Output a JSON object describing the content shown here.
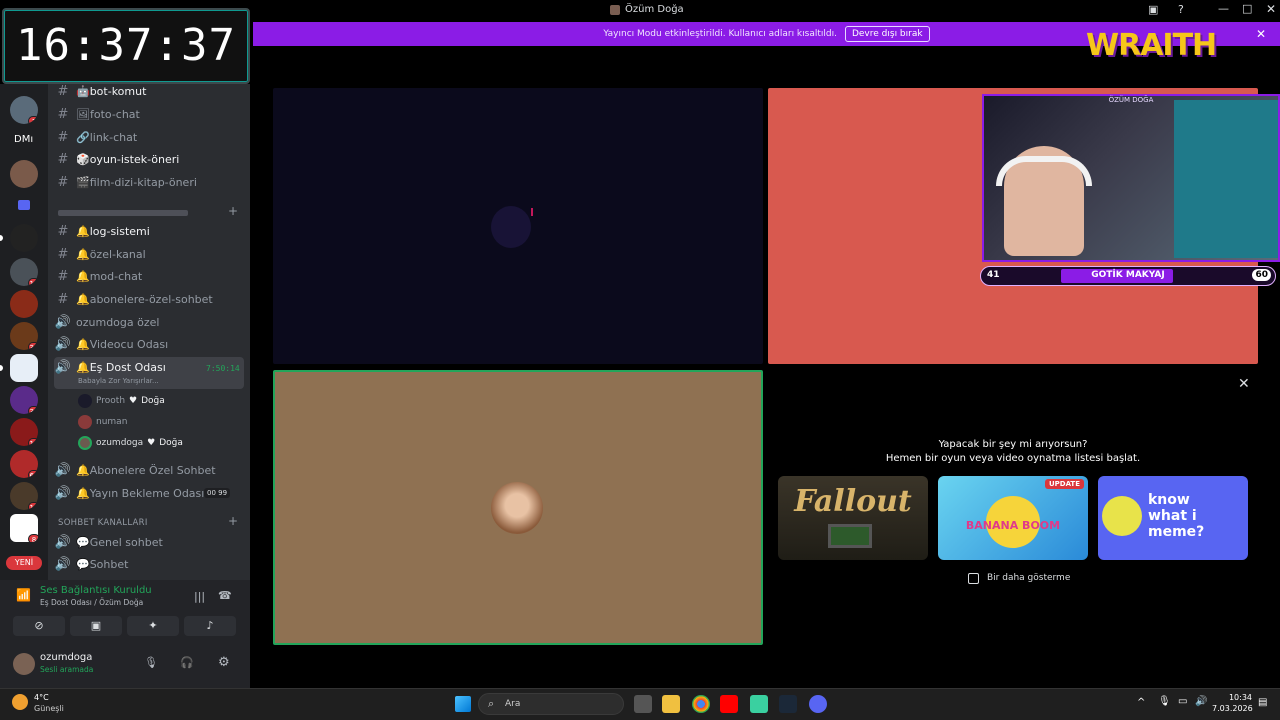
{
  "clock": "16:37:37",
  "window_title": "Özüm Doğa",
  "banner": {
    "text": "Yayıncı Modu etkinleştirildi. Kullanıcı adları kısaltıldı.",
    "button": "Devre dışı bırak"
  },
  "rail": {
    "dm_label": "DMı",
    "badges": [
      "1",
      "11",
      "32",
      "35",
      "10",
      "60",
      "17",
      "8"
    ],
    "new_label": "YENİ"
  },
  "channels": {
    "text": [
      {
        "icon": "robot",
        "name": "bot-komut",
        "unread": true
      },
      {
        "icon": "frame",
        "name": "foto-chat",
        "unread": false
      },
      {
        "icon": "link",
        "name": "link-chat",
        "unread": false
      },
      {
        "icon": "dice",
        "name": "oyun-istek-öneri",
        "unread": true
      },
      {
        "icon": "film",
        "name": "film-dizi-kitap-öneri",
        "unread": false
      }
    ],
    "mod": [
      {
        "name": "log-sistemi",
        "unread": true,
        "type": "text"
      },
      {
        "name": "özel-kanal",
        "unread": false,
        "type": "text"
      },
      {
        "name": "mod-chat",
        "unread": false,
        "type": "text"
      },
      {
        "name": "abonelere-özel-sohbet",
        "unread": false,
        "type": "text"
      },
      {
        "name": "ozumdoga özel",
        "unread": false,
        "type": "voice"
      },
      {
        "name": "Videocu Odası",
        "unread": false,
        "type": "voice"
      },
      {
        "name": "Eş Dost Odası",
        "unread": true,
        "type": "voice",
        "time": "7:50:14",
        "status": "Babayla Zor Yarışırlar..."
      }
    ],
    "voice_users": [
      {
        "name": "Prooth",
        "tag": "Doğa"
      },
      {
        "name": "numan",
        "tag": ""
      },
      {
        "name": "ozumdoga",
        "tag": "Doğa"
      }
    ],
    "after": [
      {
        "name": "Abonelere Özel Sohbet"
      },
      {
        "name": "Yayın Bekleme Odası",
        "count_a": "00",
        "count_b": "99"
      }
    ],
    "chat_category": "SOHBET KANALLARI",
    "chat": [
      {
        "name": "Genel sohbet"
      },
      {
        "name": "Sohbet"
      }
    ]
  },
  "voice_panel": {
    "status": "Ses Bağlantısı Kuruldu",
    "channel": "Eş Dost Odası / Özüm Doğa"
  },
  "user": {
    "name": "ozumdoga",
    "status": "Sesli aramada"
  },
  "overlay": {
    "brand": "WRAITH",
    "cam_label": "ÖZÜM DOĞA",
    "left_num": "41",
    "bar_text": "GOTİK MAKYAJ",
    "right_num": "60"
  },
  "activity": {
    "question": "Yapacak bir şey mi arıyorsun?",
    "sub": "Hemen bir oyun veya video oynatma listesi başlat.",
    "cards": [
      {
        "title": "Fallout",
        "badge": ""
      },
      {
        "title": "BANANA BOOM",
        "badge": "UPDATE"
      },
      {
        "title": "know what i meme?",
        "badge": ""
      }
    ],
    "checkbox": "Bir daha gösterme"
  },
  "taskbar": {
    "weather_temp": "4°C",
    "weather_desc": "Güneşli",
    "search": "Ara",
    "time": "10:34",
    "date": "7.03.2026"
  },
  "colors": {
    "accent": "#8b1ce6",
    "stage_red": "#d8594f",
    "tile_tan": "#8f7152",
    "speaking": "#23a55a"
  }
}
